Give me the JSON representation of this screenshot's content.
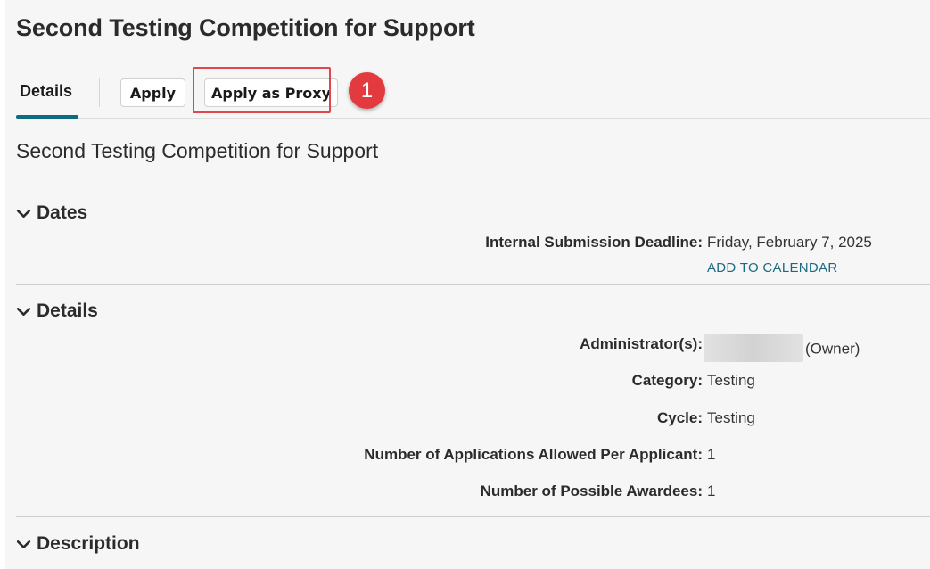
{
  "page": {
    "title": "Second Testing Competition for Support",
    "subtitle": "Second Testing Competition for Support"
  },
  "tabs": {
    "details_label": "Details",
    "apply_label": "Apply",
    "apply_proxy_label": "Apply as Proxy"
  },
  "annotation": {
    "callout_number": "1",
    "highlight_color": "#e0474c"
  },
  "sections": {
    "dates": {
      "heading": "Dates",
      "deadline_label": "Internal Submission Deadline:",
      "deadline_value": "Friday, February 7, 2025",
      "add_to_calendar": "ADD TO CALENDAR"
    },
    "details": {
      "heading": "Details",
      "administrators_label": "Administrator(s):",
      "administrators_suffix": "(Owner)",
      "category_label": "Category:",
      "category_value": "Testing",
      "cycle_label": "Cycle:",
      "cycle_value": "Testing",
      "apps_allowed_label": "Number of Applications Allowed Per Applicant:",
      "apps_allowed_value": "1",
      "awardees_label": "Number of Possible Awardees:",
      "awardees_value": "1"
    },
    "description": {
      "heading": "Description"
    }
  },
  "colors": {
    "accent_teal": "#0e6b82",
    "link": "#1a6a82",
    "callout_red": "#e23a3f"
  },
  "icons": {
    "section_toggle": "chevron-down-icon"
  }
}
